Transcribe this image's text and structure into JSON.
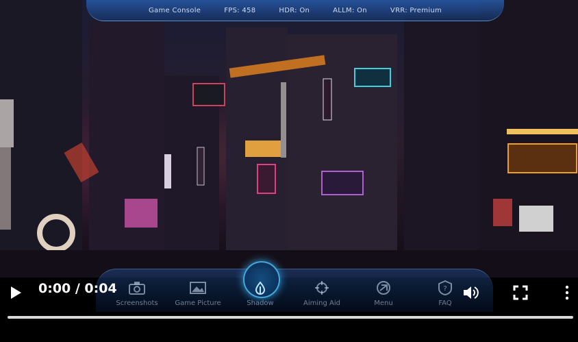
{
  "hud": {
    "items": [
      "Game Console",
      "FPS: 458",
      "HDR: On",
      "ALLM: On",
      "VRR: Premium"
    ]
  },
  "dock": {
    "items": [
      {
        "label": "Screenshots",
        "icon": "camera-icon"
      },
      {
        "label": "Game Picture",
        "icon": "picture-icon"
      },
      {
        "label": "Shadow",
        "icon": "shadow-icon",
        "active": true
      },
      {
        "label": "Aiming Aid",
        "icon": "crosshair-icon"
      },
      {
        "label": "Menu",
        "icon": "menu-icon"
      },
      {
        "label": "FAQ",
        "icon": "faq-icon"
      }
    ]
  },
  "player": {
    "time": "0:00 / 0:04",
    "progress": 0.0
  }
}
